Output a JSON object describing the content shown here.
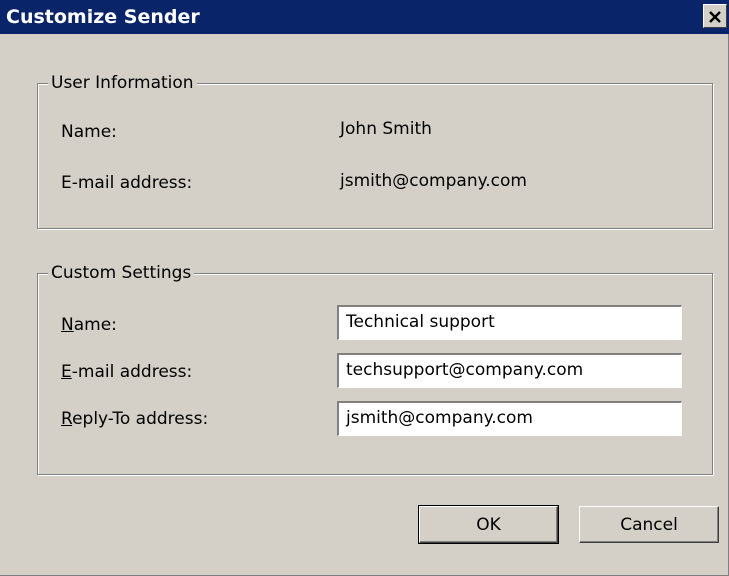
{
  "window": {
    "title": "Customize Sender",
    "close_glyph": "✕"
  },
  "user_information": {
    "legend": "User Information",
    "name_label": "Name:",
    "name_value": "John Smith",
    "email_label": "E-mail address:",
    "email_value": "jsmith@company.com"
  },
  "custom_settings": {
    "legend": "Custom Settings",
    "name_label_mnemonic": "N",
    "name_label_rest": "ame:",
    "name_value": "Technical support",
    "email_label_mnemonic": "E",
    "email_label_rest": "-mail address:",
    "email_value": "techsupport@company.com",
    "reply_label_mnemonic": "R",
    "reply_label_rest": "eply-To address:",
    "reply_value": "jsmith@company.com"
  },
  "buttons": {
    "ok": "OK",
    "cancel": "Cancel"
  }
}
